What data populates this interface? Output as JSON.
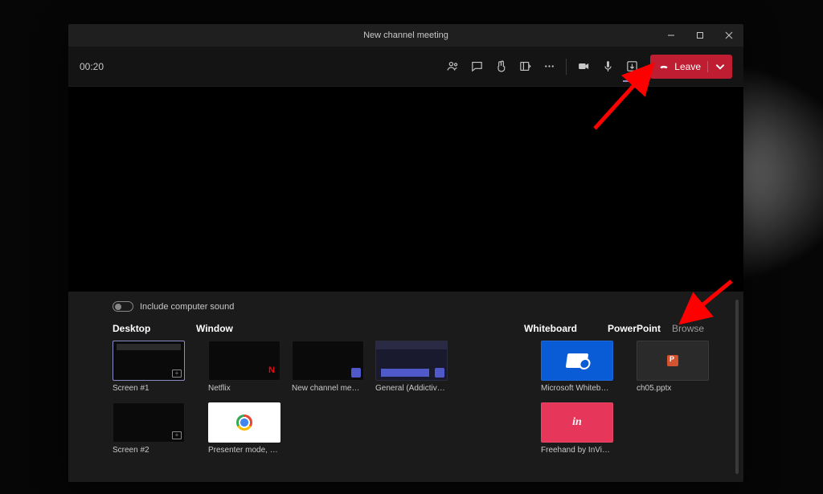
{
  "window": {
    "title": "New channel meeting"
  },
  "toolbar": {
    "timer": "00:20",
    "leave_label": "Leave"
  },
  "share": {
    "sound_label": "Include computer sound",
    "headers": {
      "desktop": "Desktop",
      "window": "Window",
      "whiteboard": "Whiteboard",
      "powerpoint": "PowerPoint",
      "browse": "Browse"
    },
    "desktop": [
      {
        "label": "Screen #1"
      },
      {
        "label": "Screen #2"
      }
    ],
    "windows": [
      {
        "label": "Netflix"
      },
      {
        "label": "New channel meeting | …"
      },
      {
        "label": "General (AddictiveTips - …"
      },
      {
        "label": "Presenter mode, notes a…"
      }
    ],
    "whiteboard": [
      {
        "label": "Microsoft Whiteboard"
      },
      {
        "label": "Freehand by InVision"
      }
    ],
    "powerpoint": [
      {
        "label": "ch05.pptx"
      }
    ]
  }
}
